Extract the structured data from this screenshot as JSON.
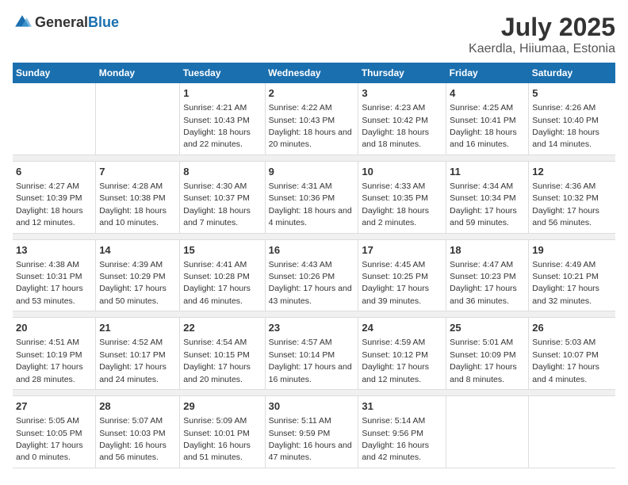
{
  "logo": {
    "general": "General",
    "blue": "Blue"
  },
  "title": "July 2025",
  "location": "Kaerdla, Hiiumaa, Estonia",
  "weekdays": [
    "Sunday",
    "Monday",
    "Tuesday",
    "Wednesday",
    "Thursday",
    "Friday",
    "Saturday"
  ],
  "weeks": [
    [
      {
        "day": "",
        "sunrise": "",
        "sunset": "",
        "daylight": ""
      },
      {
        "day": "",
        "sunrise": "",
        "sunset": "",
        "daylight": ""
      },
      {
        "day": "1",
        "sunrise": "Sunrise: 4:21 AM",
        "sunset": "Sunset: 10:43 PM",
        "daylight": "Daylight: 18 hours and 22 minutes."
      },
      {
        "day": "2",
        "sunrise": "Sunrise: 4:22 AM",
        "sunset": "Sunset: 10:43 PM",
        "daylight": "Daylight: 18 hours and 20 minutes."
      },
      {
        "day": "3",
        "sunrise": "Sunrise: 4:23 AM",
        "sunset": "Sunset: 10:42 PM",
        "daylight": "Daylight: 18 hours and 18 minutes."
      },
      {
        "day": "4",
        "sunrise": "Sunrise: 4:25 AM",
        "sunset": "Sunset: 10:41 PM",
        "daylight": "Daylight: 18 hours and 16 minutes."
      },
      {
        "day": "5",
        "sunrise": "Sunrise: 4:26 AM",
        "sunset": "Sunset: 10:40 PM",
        "daylight": "Daylight: 18 hours and 14 minutes."
      }
    ],
    [
      {
        "day": "6",
        "sunrise": "Sunrise: 4:27 AM",
        "sunset": "Sunset: 10:39 PM",
        "daylight": "Daylight: 18 hours and 12 minutes."
      },
      {
        "day": "7",
        "sunrise": "Sunrise: 4:28 AM",
        "sunset": "Sunset: 10:38 PM",
        "daylight": "Daylight: 18 hours and 10 minutes."
      },
      {
        "day": "8",
        "sunrise": "Sunrise: 4:30 AM",
        "sunset": "Sunset: 10:37 PM",
        "daylight": "Daylight: 18 hours and 7 minutes."
      },
      {
        "day": "9",
        "sunrise": "Sunrise: 4:31 AM",
        "sunset": "Sunset: 10:36 PM",
        "daylight": "Daylight: 18 hours and 4 minutes."
      },
      {
        "day": "10",
        "sunrise": "Sunrise: 4:33 AM",
        "sunset": "Sunset: 10:35 PM",
        "daylight": "Daylight: 18 hours and 2 minutes."
      },
      {
        "day": "11",
        "sunrise": "Sunrise: 4:34 AM",
        "sunset": "Sunset: 10:34 PM",
        "daylight": "Daylight: 17 hours and 59 minutes."
      },
      {
        "day": "12",
        "sunrise": "Sunrise: 4:36 AM",
        "sunset": "Sunset: 10:32 PM",
        "daylight": "Daylight: 17 hours and 56 minutes."
      }
    ],
    [
      {
        "day": "13",
        "sunrise": "Sunrise: 4:38 AM",
        "sunset": "Sunset: 10:31 PM",
        "daylight": "Daylight: 17 hours and 53 minutes."
      },
      {
        "day": "14",
        "sunrise": "Sunrise: 4:39 AM",
        "sunset": "Sunset: 10:29 PM",
        "daylight": "Daylight: 17 hours and 50 minutes."
      },
      {
        "day": "15",
        "sunrise": "Sunrise: 4:41 AM",
        "sunset": "Sunset: 10:28 PM",
        "daylight": "Daylight: 17 hours and 46 minutes."
      },
      {
        "day": "16",
        "sunrise": "Sunrise: 4:43 AM",
        "sunset": "Sunset: 10:26 PM",
        "daylight": "Daylight: 17 hours and 43 minutes."
      },
      {
        "day": "17",
        "sunrise": "Sunrise: 4:45 AM",
        "sunset": "Sunset: 10:25 PM",
        "daylight": "Daylight: 17 hours and 39 minutes."
      },
      {
        "day": "18",
        "sunrise": "Sunrise: 4:47 AM",
        "sunset": "Sunset: 10:23 PM",
        "daylight": "Daylight: 17 hours and 36 minutes."
      },
      {
        "day": "19",
        "sunrise": "Sunrise: 4:49 AM",
        "sunset": "Sunset: 10:21 PM",
        "daylight": "Daylight: 17 hours and 32 minutes."
      }
    ],
    [
      {
        "day": "20",
        "sunrise": "Sunrise: 4:51 AM",
        "sunset": "Sunset: 10:19 PM",
        "daylight": "Daylight: 17 hours and 28 minutes."
      },
      {
        "day": "21",
        "sunrise": "Sunrise: 4:52 AM",
        "sunset": "Sunset: 10:17 PM",
        "daylight": "Daylight: 17 hours and 24 minutes."
      },
      {
        "day": "22",
        "sunrise": "Sunrise: 4:54 AM",
        "sunset": "Sunset: 10:15 PM",
        "daylight": "Daylight: 17 hours and 20 minutes."
      },
      {
        "day": "23",
        "sunrise": "Sunrise: 4:57 AM",
        "sunset": "Sunset: 10:14 PM",
        "daylight": "Daylight: 17 hours and 16 minutes."
      },
      {
        "day": "24",
        "sunrise": "Sunrise: 4:59 AM",
        "sunset": "Sunset: 10:12 PM",
        "daylight": "Daylight: 17 hours and 12 minutes."
      },
      {
        "day": "25",
        "sunrise": "Sunrise: 5:01 AM",
        "sunset": "Sunset: 10:09 PM",
        "daylight": "Daylight: 17 hours and 8 minutes."
      },
      {
        "day": "26",
        "sunrise": "Sunrise: 5:03 AM",
        "sunset": "Sunset: 10:07 PM",
        "daylight": "Daylight: 17 hours and 4 minutes."
      }
    ],
    [
      {
        "day": "27",
        "sunrise": "Sunrise: 5:05 AM",
        "sunset": "Sunset: 10:05 PM",
        "daylight": "Daylight: 17 hours and 0 minutes."
      },
      {
        "day": "28",
        "sunrise": "Sunrise: 5:07 AM",
        "sunset": "Sunset: 10:03 PM",
        "daylight": "Daylight: 16 hours and 56 minutes."
      },
      {
        "day": "29",
        "sunrise": "Sunrise: 5:09 AM",
        "sunset": "Sunset: 10:01 PM",
        "daylight": "Daylight: 16 hours and 51 minutes."
      },
      {
        "day": "30",
        "sunrise": "Sunrise: 5:11 AM",
        "sunset": "Sunset: 9:59 PM",
        "daylight": "Daylight: 16 hours and 47 minutes."
      },
      {
        "day": "31",
        "sunrise": "Sunrise: 5:14 AM",
        "sunset": "Sunset: 9:56 PM",
        "daylight": "Daylight: 16 hours and 42 minutes."
      },
      {
        "day": "",
        "sunrise": "",
        "sunset": "",
        "daylight": ""
      },
      {
        "day": "",
        "sunrise": "",
        "sunset": "",
        "daylight": ""
      }
    ]
  ]
}
